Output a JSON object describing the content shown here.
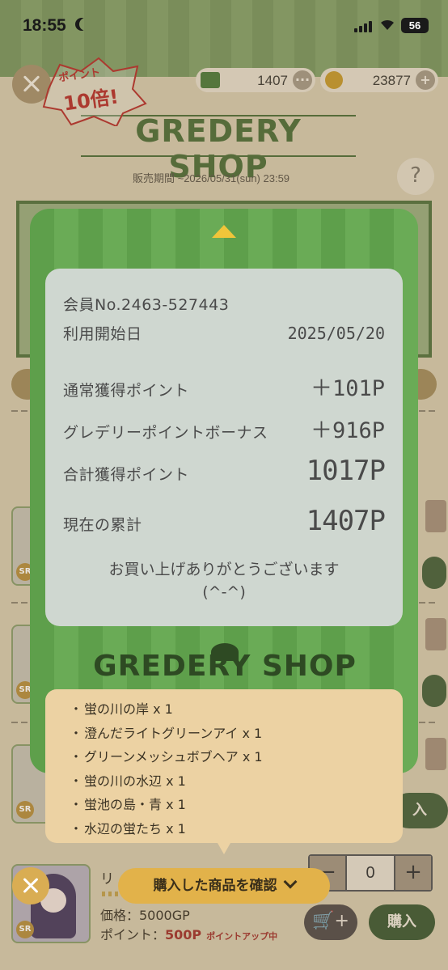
{
  "status_bar": {
    "time": "18:55",
    "battery": "56"
  },
  "header": {
    "badge_top": "ポイント",
    "badge_main": "10倍!",
    "gp_amount": "1407",
    "coin_amount": "23877",
    "shop_name": "GREDERY SHOP",
    "sale_period": "販売期間 ~2026/05/31(sun) 23:59",
    "help_label": "?"
  },
  "receipt": {
    "member_no": "会員No.2463-527443",
    "start_label": "利用開始日",
    "start_date": "2025/05/20",
    "normal_label": "通常獲得ポイント",
    "normal_value": "＋101P",
    "bonus_label": "グレデリーポイントボーナス",
    "bonus_value": "＋916P",
    "total_label": "合計獲得ポイント",
    "total_value": "1017P",
    "current_label": "現在の累計",
    "current_value": "1407P",
    "thanks_line1": "お買い上げありがとうございます",
    "thanks_line2": "(^-^)"
  },
  "modal_logo": "GREDERY SHOP",
  "purchased_items": [
    "蛍の川の岸 x 1",
    "澄んだライトグリーンアイ x 1",
    "グリーンメッシュボブヘア x 1",
    "蛍の川の水辺 x 1",
    "蛍池の島・青 x 1",
    "水辺の蛍たち x 1"
  ],
  "confirm_button": "購入した商品を確認",
  "product": {
    "rarity": "SR",
    "name": "リ",
    "price": "価格：5000GP",
    "points_label": "ポイント：",
    "points_value": "500P",
    "points_up": "ポイントアップ中",
    "qty": "0",
    "minus": "−",
    "plus": "+",
    "buy": "購入",
    "cart": "🛒+"
  },
  "rarity_labels": [
    "SR",
    "SR",
    "SR"
  ],
  "side_buy": "入",
  "colors": {
    "modal_green": "#5e9f4b",
    "receipt_bg": "#cfd7d0",
    "items_bg": "#ecd2a3",
    "confirm_bg": "#e2b24a",
    "accent_red": "#a3322b"
  }
}
